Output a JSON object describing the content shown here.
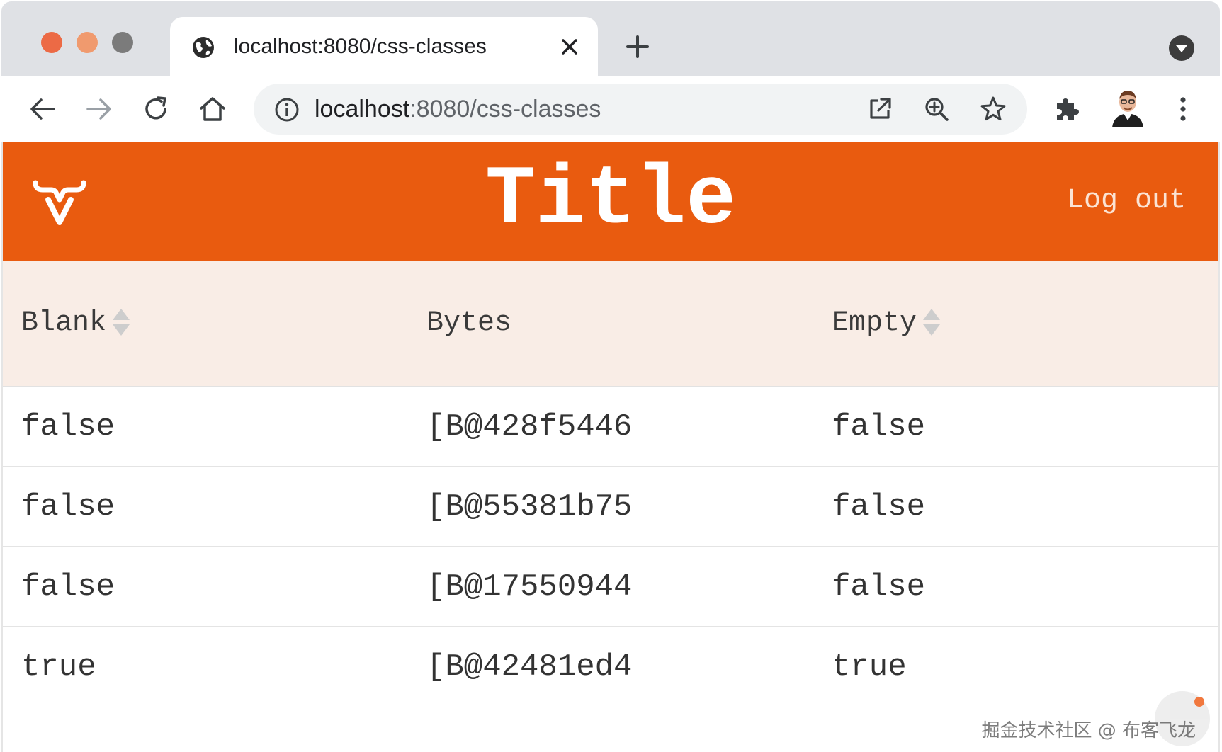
{
  "browser": {
    "tab": {
      "title": "localhost:8080/css-classes",
      "favicon": "globe-icon",
      "close_icon": "close-icon"
    },
    "new_tab_icon": "plus-icon",
    "tab_menu_icon": "chevron-down-icon",
    "toolbar": {
      "back_icon": "arrow-left-icon",
      "forward_icon": "arrow-right-icon",
      "reload_icon": "reload-icon",
      "home_icon": "home-icon",
      "site_info_icon": "info-icon",
      "url_host": "localhost",
      "url_path": ":8080/css-classes",
      "open_external_icon": "open-external-icon",
      "zoom_icon": "zoom-in-icon",
      "bookmark_icon": "star-icon",
      "extensions_icon": "puzzle-icon",
      "profile_icon": "avatar",
      "menu_icon": "kebab-menu-icon"
    }
  },
  "app": {
    "logo": "vaadin-logo",
    "title": "Title",
    "logout_label": "Log out",
    "accent_color": "#e95b0f"
  },
  "grid": {
    "columns": [
      {
        "label": "Blank",
        "sortable": true
      },
      {
        "label": "Bytes",
        "sortable": false
      },
      {
        "label": "Empty",
        "sortable": true
      }
    ],
    "rows": [
      [
        "false",
        "[B@428f5446",
        "false"
      ],
      [
        "false",
        "[B@55381b75",
        "false"
      ],
      [
        "false",
        "[B@17550944",
        "false"
      ],
      [
        "true",
        "[B@42481ed4",
        "true"
      ]
    ]
  },
  "watermark": "掘金技术社区 @ 布客飞龙"
}
